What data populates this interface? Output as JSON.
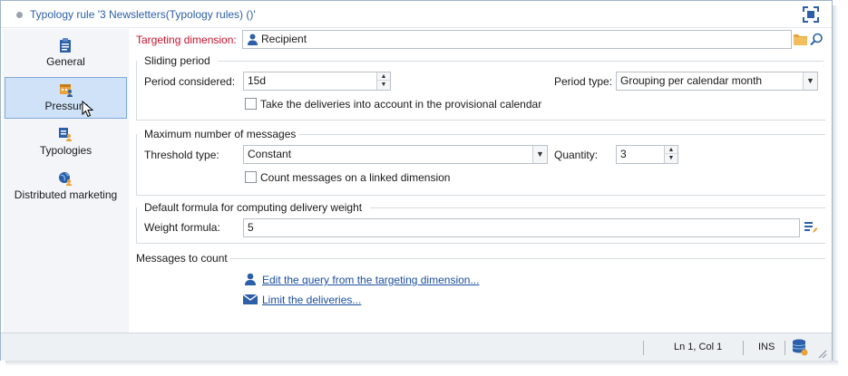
{
  "window": {
    "title": "Typology rule '3 Newsletters(Typology rules) ()'"
  },
  "sidebar": {
    "items": [
      {
        "label": "General",
        "icon": "clipboard-icon",
        "active": false
      },
      {
        "label": "Pressure",
        "icon": "calendar-user-icon",
        "active": true
      },
      {
        "label": "Typologies",
        "icon": "typology-user-icon",
        "active": false
      },
      {
        "label": "Distributed marketing",
        "icon": "globe-user-icon",
        "active": false
      }
    ]
  },
  "targeting": {
    "label": "Targeting dimension:",
    "value": "Recipient"
  },
  "sliding": {
    "title": "Sliding period",
    "period_label": "Period considered:",
    "period_value": "15d",
    "period_type_label": "Period type:",
    "period_type_value": "Grouping per calendar month",
    "provisional_label": "Take the deliveries into account in the provisional calendar"
  },
  "maxmsg": {
    "title": "Maximum number of messages",
    "threshold_label": "Threshold type:",
    "threshold_value": "Constant",
    "quantity_label": "Quantity:",
    "quantity_value": "3",
    "linked_label": "Count messages on a linked dimension"
  },
  "weight": {
    "title": "Default formula for computing delivery weight",
    "formula_label": "Weight formula:",
    "formula_value": "5"
  },
  "count": {
    "title": "Messages to count",
    "link_query": "Edit the query from the targeting dimension...",
    "link_deliveries": "Limit the deliveries..."
  },
  "status": {
    "position": "Ln 1, Col 1",
    "mode": "INS"
  },
  "colors": {
    "accent": "#2c5fa8",
    "required": "#c8102e",
    "selected": "#cfe2f7"
  }
}
